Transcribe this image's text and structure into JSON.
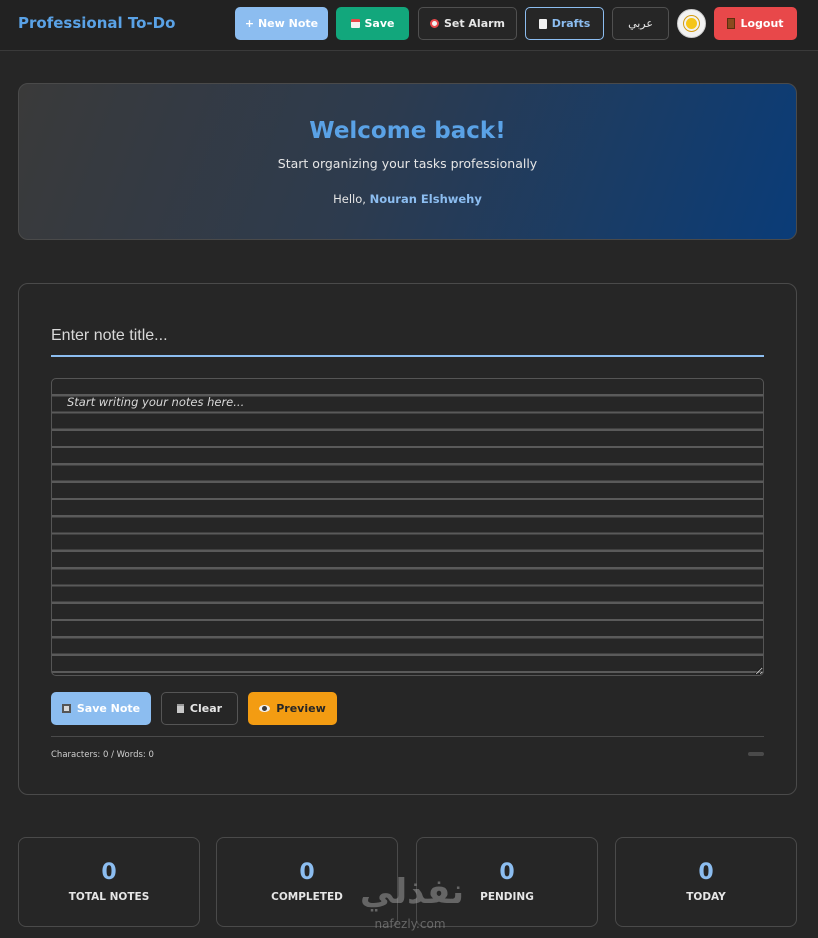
{
  "header": {
    "brand": "Professional To-Do",
    "new_note": "+ New Note",
    "save": "Save",
    "set_alarm": "Set Alarm",
    "drafts": "Drafts",
    "language": "عربي",
    "logout": "Logout"
  },
  "welcome": {
    "title": "Welcome back!",
    "subtitle": "Start organizing your tasks professionally",
    "hello": "Hello,",
    "user_name": "Nouran Elshwehy"
  },
  "editor": {
    "title_placeholder": "Enter note title...",
    "body_placeholder": "Start writing your notes here...",
    "save_note": "Save Note",
    "clear": "Clear",
    "preview": "Preview",
    "counter": "Characters: 0 / Words: 0"
  },
  "stats": [
    {
      "value": "0",
      "label": "TOTAL NOTES"
    },
    {
      "value": "0",
      "label": "COMPLETED"
    },
    {
      "value": "0",
      "label": "PENDING"
    },
    {
      "value": "0",
      "label": "TODAY"
    }
  ],
  "watermark": {
    "glyph": "نفذلي",
    "url": "nafezly.com"
  },
  "colors": {
    "accent": "#5aa2e6",
    "accent_light": "#8cbdf0",
    "save_green": "#12a77c",
    "logout_red": "#e8484a",
    "preview_orange": "#f39c12",
    "background": "#262626"
  }
}
